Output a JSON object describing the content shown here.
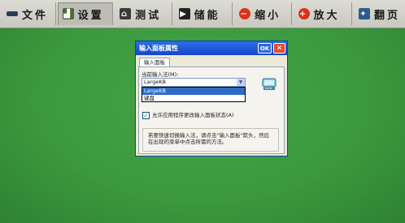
{
  "colors": {
    "desktop": "#3f9a41",
    "taskbar": "#d4d4cc",
    "titlebar": "#1f58d6",
    "dialog": "#ece9d8",
    "selection": "#316ac5"
  },
  "taskbar": {
    "items": [
      {
        "label": "文件",
        "icon": "file-icon"
      },
      {
        "label": "设置",
        "icon": "settings-icon"
      },
      {
        "label": "测试",
        "icon": "test-icon"
      },
      {
        "label": "储能",
        "icon": "storage-icon"
      },
      {
        "label": "缩小",
        "icon": "zoom-out-icon"
      },
      {
        "label": "放大",
        "icon": "zoom-in-icon"
      },
      {
        "label": "翻页",
        "icon": "page-icon"
      }
    ]
  },
  "dialog": {
    "title": "输入面板属性",
    "ok_label": "OK",
    "close_label": "✕",
    "tab_label": "输入面板",
    "current_method_label": "当前输入法(M):",
    "combo_value": "LargeKB",
    "dropdown_options": [
      "LargeKB",
      "键盘"
    ],
    "checkbox_label": "允许应用程序更改输入面板状态(A)",
    "checkbox_checked": true,
    "help_text": "若要快速切换输入法，请点击\"输入面板\"箭头，然后在出现的菜单中点击所需的方法。"
  }
}
